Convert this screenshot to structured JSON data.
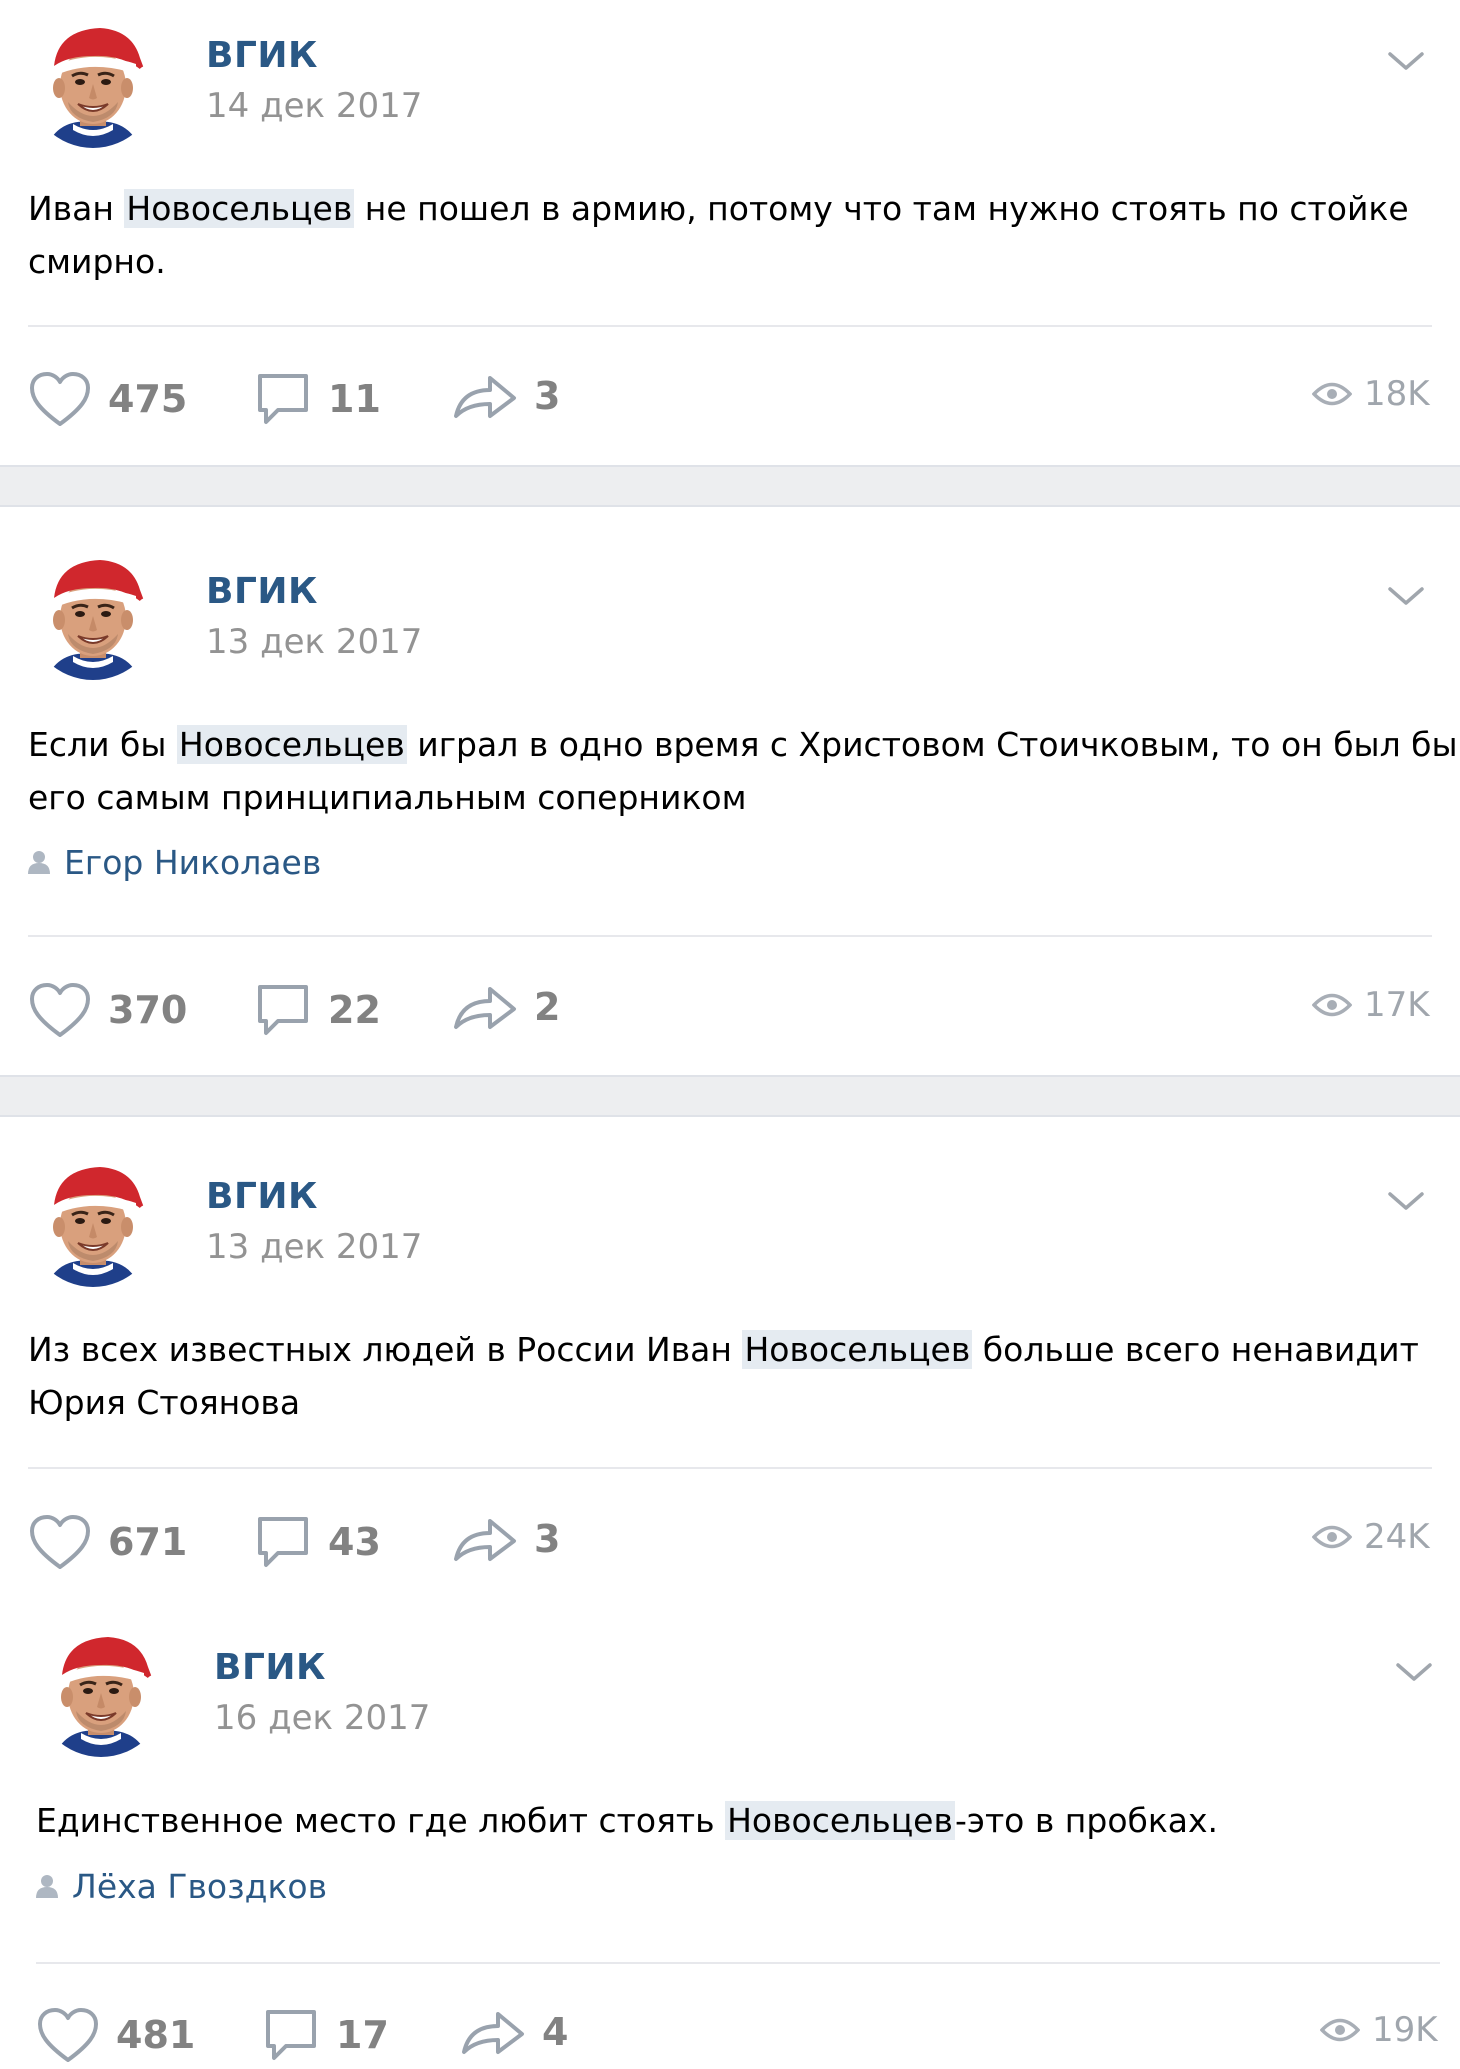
{
  "posts": [
    {
      "author": "ВГИК",
      "date": "14 дек 2017",
      "text_lines": [
        [
          "Иван ",
          "Новосельцев",
          " не пошел в армию, потому что там нужно стоять по стойке"
        ],
        [
          "смирно.",
          "",
          ""
        ]
      ],
      "signer": "",
      "likes": "475",
      "comments": "11",
      "shares": "3",
      "views": "18K"
    },
    {
      "author": "ВГИК",
      "date": "13 дек 2017",
      "text_lines": [
        [
          "Если бы ",
          "Новосельцев",
          " играл в одно время с Христовом Стоичковым, то он был бы"
        ],
        [
          "его самым принципиальным соперником",
          "",
          ""
        ]
      ],
      "signer": "Егор Николаев",
      "likes": "370",
      "comments": "22",
      "shares": "2",
      "views": "17K"
    },
    {
      "author": "ВГИК",
      "date": "13 дек 2017",
      "text_lines": [
        [
          "Из всех известных людей в России Иван ",
          "Новосельцев",
          " больше всего ненавидит"
        ],
        [
          "Юрия Стоянова",
          "",
          ""
        ]
      ],
      "signer": "",
      "likes": "671",
      "comments": "43",
      "shares": "3",
      "views": "24K"
    },
    {
      "author": "ВГИК",
      "date": "16 дек 2017",
      "text_lines": [
        [
          "Единственное место где любит стоять ",
          "Новосельцев",
          "-это в пробках."
        ]
      ],
      "signer": "Лёха Гвоздков",
      "likes": "481",
      "comments": "17",
      "shares": "4",
      "views": "19K"
    }
  ],
  "colors": {
    "author": "#2a5885",
    "date": "#939393",
    "highlight": "#e5ebf1",
    "action": "#828282",
    "separator": "#e7e8ec",
    "gap": "#edeef0"
  },
  "icons": {
    "like": "heart-icon",
    "comment": "comment-icon",
    "share": "share-arrow-icon",
    "views": "eye-icon",
    "menu": "chevron-down-icon",
    "signer": "person-icon"
  }
}
